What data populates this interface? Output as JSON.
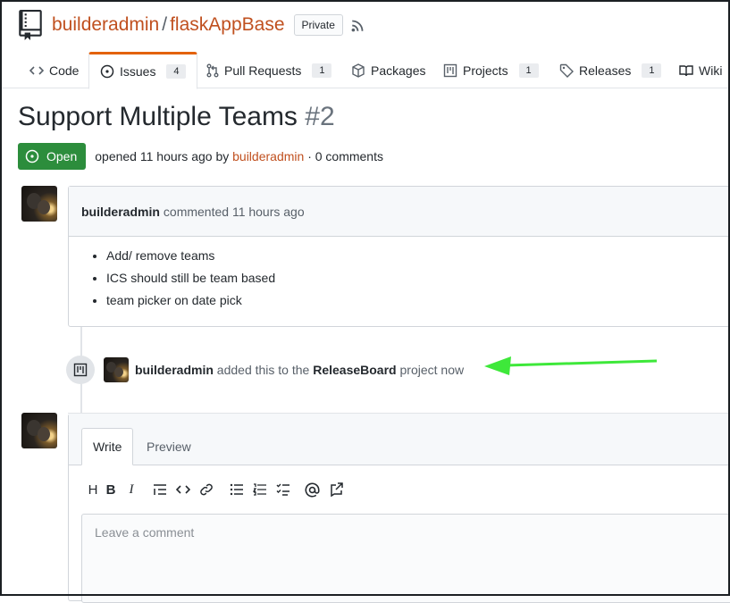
{
  "repo": {
    "owner": "builderadmin",
    "separator": "/",
    "name": "flaskAppBase",
    "visibility": "Private"
  },
  "tabs": [
    {
      "label": "Code",
      "icon": "code-icon"
    },
    {
      "label": "Issues",
      "icon": "issue-opened-icon",
      "count": "4",
      "selected": true
    },
    {
      "label": "Pull Requests",
      "icon": "git-pull-request-icon",
      "count": "1"
    },
    {
      "label": "Packages",
      "icon": "package-icon"
    },
    {
      "label": "Projects",
      "icon": "project-icon",
      "count": "1"
    },
    {
      "label": "Releases",
      "icon": "tag-icon",
      "count": "1"
    },
    {
      "label": "Wiki",
      "icon": "book-icon"
    }
  ],
  "issue": {
    "title": "Support Multiple Teams",
    "number": "#2",
    "state": "Open",
    "meta_opened": "opened 11 hours ago by",
    "meta_author": "builderadmin",
    "meta_comments": "· 0 comments"
  },
  "comment": {
    "author": "builderadmin",
    "time": "commented 11 hours ago",
    "items": [
      "Add/ remove teams",
      "ICS should still be team based",
      "team picker on date pick"
    ]
  },
  "event": {
    "actor": "builderadmin",
    "text_before": "added this to the",
    "project": "ReleaseBoard",
    "text_after": "project now"
  },
  "annotation": {
    "arrow_color": "#3ee83a"
  },
  "new_comment": {
    "write_tab": "Write",
    "preview_tab": "Preview",
    "toolbar": [
      "H",
      "B",
      "I"
    ],
    "placeholder": "Leave a comment"
  },
  "colors": {
    "accent": "#c0501f",
    "open_state": "#2c8d3c",
    "selected_tab": "#e36209"
  }
}
